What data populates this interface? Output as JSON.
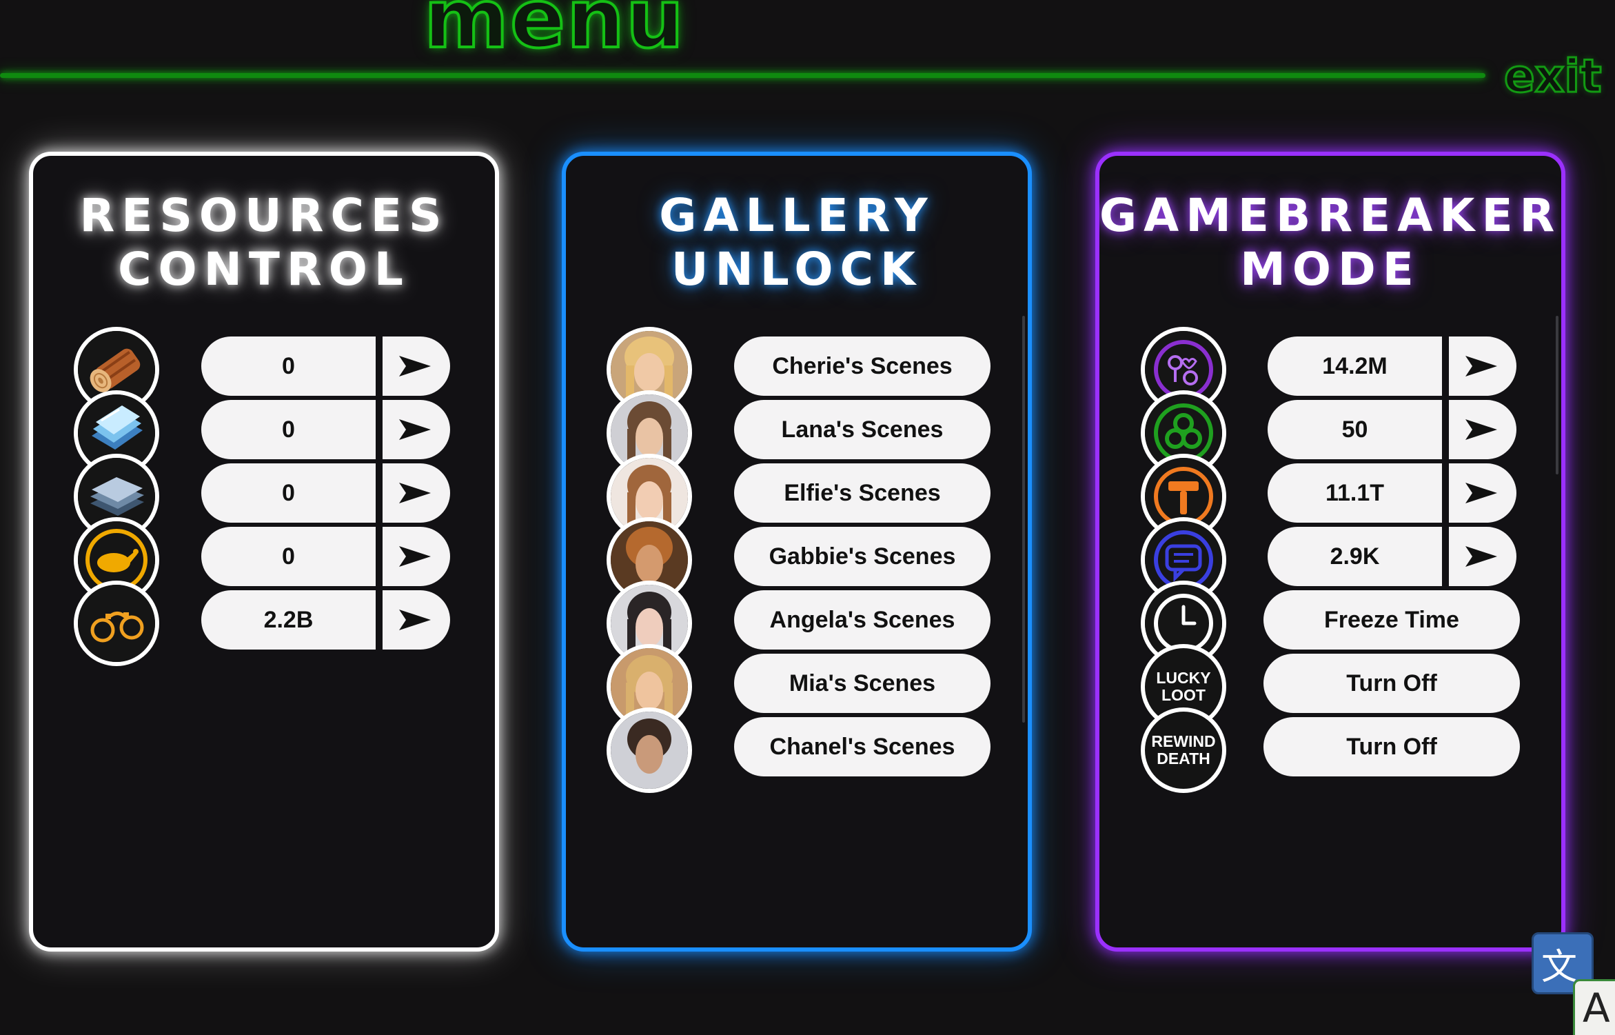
{
  "header": {
    "title": "menu",
    "exit_label": "exit",
    "accent_color": "#15c015"
  },
  "resources_panel": {
    "title_line1": "RESOURCES",
    "title_line2": "CONTROL",
    "border_color": "#ffffff",
    "items": [
      {
        "icon": "wood-log-icon",
        "value": "0"
      },
      {
        "icon": "glass-panes-icon",
        "value": "0"
      },
      {
        "icon": "steel-plates-icon",
        "value": "0"
      },
      {
        "icon": "roast-chicken-icon",
        "value": "0"
      },
      {
        "icon": "handcuffs-icon",
        "value": "2.2B"
      }
    ]
  },
  "gallery_panel": {
    "title_line1": "GALLERY",
    "title_line2": "UNLOCK",
    "border_color": "#1a8fff",
    "items": [
      {
        "icon": "cherie-avatar",
        "label": "Cherie's Scenes"
      },
      {
        "icon": "lana-avatar",
        "label": "Lana's Scenes"
      },
      {
        "icon": "elfie-avatar",
        "label": "Elfie's Scenes"
      },
      {
        "icon": "gabbie-avatar",
        "label": "Gabbie's Scenes"
      },
      {
        "icon": "angela-avatar",
        "label": "Angela's Scenes"
      },
      {
        "icon": "mia-avatar",
        "label": "Mia's Scenes"
      },
      {
        "icon": "chanel-avatar",
        "label": "Chanel's Scenes"
      }
    ]
  },
  "gamebreaker_panel": {
    "title_line1": "GAMEBREAKER",
    "title_line2": "MODE",
    "border_color": "#9b30ff",
    "items": [
      {
        "icon": "purple-toys-icon",
        "value": "14.2M"
      },
      {
        "icon": "biohazard-icon",
        "value": "50"
      },
      {
        "icon": "hammer-icon",
        "value": "11.1T"
      },
      {
        "icon": "chat-bubble-icon",
        "value": "2.9K"
      },
      {
        "icon": "clock-icon",
        "label": "Freeze Time"
      },
      {
        "badge_line1": "LUCKY",
        "badge_line2": "LOOT",
        "label": "Turn Off"
      },
      {
        "badge_line1": "REWIND",
        "badge_line2": "DEATH",
        "label": "Turn Off"
      }
    ]
  },
  "translate_widget": {
    "glyph_zh": "文",
    "glyph_en": "A"
  }
}
